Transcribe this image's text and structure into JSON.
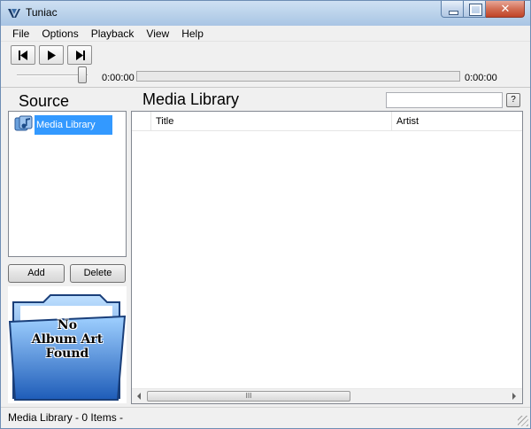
{
  "window": {
    "title": "Tuniac",
    "close_glyph": "✕"
  },
  "menu": [
    "File",
    "Options",
    "Playback",
    "View",
    "Help"
  ],
  "transport": {
    "prev_icon": "previous-track-icon",
    "play_icon": "play-icon",
    "next_icon": "next-track-icon",
    "time_elapsed": "0:00:00",
    "time_total": "0:00:00"
  },
  "source": {
    "title": "Source",
    "items": [
      {
        "label": "Media Library",
        "icon": "media-library-icon"
      }
    ],
    "add_label": "Add",
    "delete_label": "Delete",
    "album_art_text": [
      "No",
      "Album Art",
      "Found"
    ]
  },
  "library": {
    "title": "Media Library",
    "search_value": "",
    "help_label": "?",
    "columns": [
      "Title",
      "Artist"
    ],
    "rows": [],
    "hscroll_grip": "III"
  },
  "status": {
    "text": "Media Library - 0 Items -"
  },
  "colors": {
    "selection": "#3399ff",
    "titlebar": "#b9d1ea",
    "folder_blue": "#3d7fd6"
  }
}
